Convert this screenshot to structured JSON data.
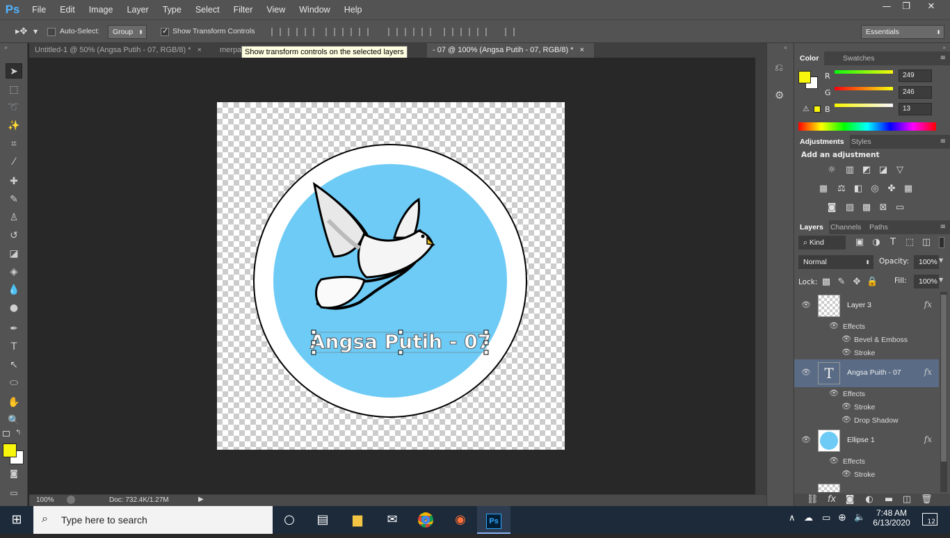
{
  "app": {
    "logo": "Ps",
    "menu": [
      "File",
      "Edit",
      "Image",
      "Layer",
      "Type",
      "Select",
      "Filter",
      "View",
      "Window",
      "Help"
    ],
    "window_controls": [
      "—",
      "❐",
      "✕"
    ]
  },
  "options_bar": {
    "auto_select_label": "Auto-Select:",
    "auto_select_value": "Group",
    "show_transform_label": "Show Transform Controls",
    "workspace": "Essentials"
  },
  "tabs": [
    {
      "label": "Untitled-1 @ 50% (Angsa Putih - 07, RGB/8) *",
      "close": "×"
    },
    {
      "label": "merpa",
      "close": ""
    },
    {
      "label": "- 07 @ 100% (Angsa Putih - 07, RGB/8) *",
      "close": "×"
    }
  ],
  "tooltip": "Show transform controls on the selected layers",
  "canvas": {
    "text_layer": "Angsa Putih - 07",
    "colors": {
      "circle_fill": "#6ecbf5",
      "ring": "#ffffff",
      "outline": "#000000",
      "text": "#ffffff"
    }
  },
  "status": {
    "zoom": "100%",
    "doc": "Doc: 732.4K/1.27M"
  },
  "color_panel": {
    "tabs": [
      "Color",
      "Swatches"
    ],
    "fg_color": "#f9f60d",
    "channels": [
      {
        "label": "R",
        "value": "249"
      },
      {
        "label": "G",
        "value": "246"
      },
      {
        "label": "B",
        "value": "13"
      }
    ],
    "warning_icon": "⚠"
  },
  "adjustments_panel": {
    "tabs": [
      "Adjustments",
      "Styles"
    ],
    "heading": "Add an adjustment"
  },
  "layers_panel": {
    "tabs": [
      "Layers",
      "Channels",
      "Paths"
    ],
    "filter_kind": "Kind",
    "blend_mode": "Normal",
    "opacity_label": "Opacity:",
    "opacity": "100%",
    "lock_label": "Lock:",
    "fill_label": "Fill:",
    "fill": "100%",
    "layers": [
      {
        "name": "Layer 3",
        "effects_label": "Effects",
        "effects": [
          "Bevel & Emboss",
          "Stroke"
        ]
      },
      {
        "name": "Angsa Puith - 07",
        "effects_label": "Effects",
        "effects": [
          "Stroke",
          "Drop Shadow"
        ]
      },
      {
        "name": "Ellipse 1",
        "effects_label": "Effects",
        "effects": [
          "Stroke"
        ]
      }
    ],
    "fx": "fx"
  },
  "taskbar": {
    "search_placeholder": "Type here to search",
    "time": "7:48 AM",
    "date": "6/13/2020",
    "notification_count": "12"
  }
}
